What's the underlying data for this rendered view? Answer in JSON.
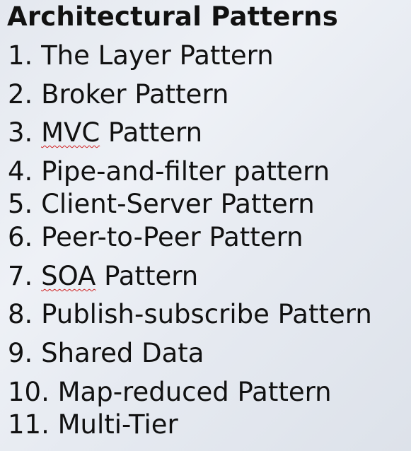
{
  "title": "Architectural Patterns",
  "items": [
    {
      "number": "1.",
      "text": "The Layer Pattern"
    },
    {
      "number": "2.",
      "text": "Broker Pattern"
    },
    {
      "number": "3.",
      "prefix": "",
      "flagged": "MVC",
      "text": " Pattern"
    },
    {
      "number": "4.",
      "text": "Pipe-and-filter pattern"
    },
    {
      "number": "5.",
      "text": "Client-Server Pattern"
    },
    {
      "number": "6.",
      "text": "Peer-to-Peer Pattern"
    },
    {
      "number": "7.",
      "prefix": "",
      "flagged": "SOA",
      "text": " Pattern"
    },
    {
      "number": "8.",
      "text": "Publish-subscribe Pattern"
    },
    {
      "number": "9.",
      "text": "Shared Data"
    },
    {
      "number": "10.",
      "text": "Map-reduced Pattern"
    },
    {
      "number": "11.",
      "text": "Multi-Tier"
    }
  ],
  "colors": {
    "text": "#111111",
    "spellcheck_underline": "#d02020"
  }
}
